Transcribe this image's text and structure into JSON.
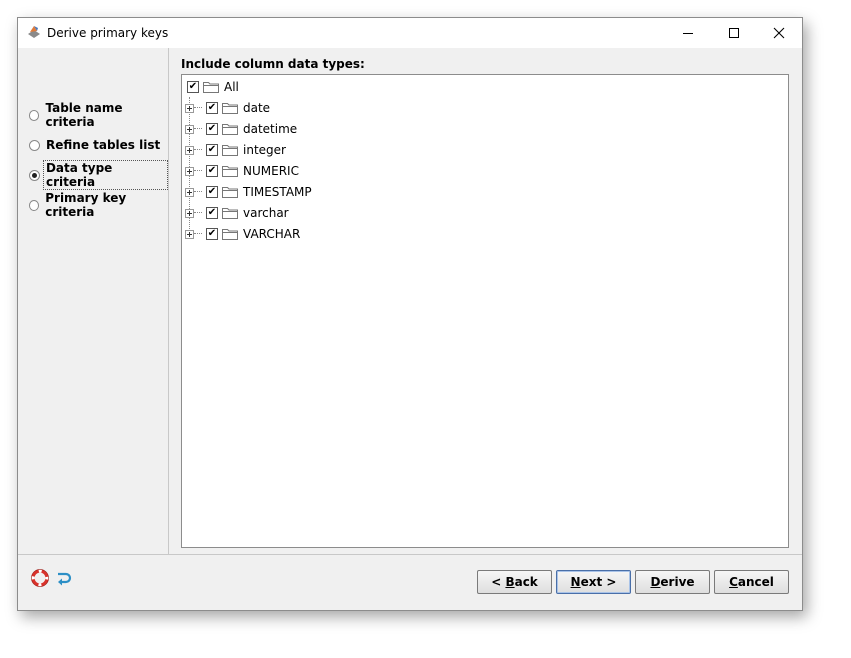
{
  "window": {
    "title": "Derive primary keys"
  },
  "steps": [
    {
      "label": "Table name criteria",
      "selected": false
    },
    {
      "label": "Refine tables list",
      "selected": false
    },
    {
      "label": "Data type criteria",
      "selected": true
    },
    {
      "label": "Primary key criteria",
      "selected": false
    }
  ],
  "content": {
    "label": "Include column data types:",
    "tree": {
      "root": {
        "label": "All",
        "checked": true
      },
      "items": [
        {
          "label": "date",
          "checked": true
        },
        {
          "label": "datetime",
          "checked": true
        },
        {
          "label": "integer",
          "checked": true
        },
        {
          "label": "NUMERIC",
          "checked": true
        },
        {
          "label": "TIMESTAMP",
          "checked": true
        },
        {
          "label": "varchar",
          "checked": true
        },
        {
          "label": "VARCHAR",
          "checked": true
        }
      ]
    }
  },
  "buttons": {
    "back_prefix": "< ",
    "back_mnemonic": "B",
    "back_rest": "ack",
    "next_mnemonic": "N",
    "next_rest": "ext >",
    "derive_mnemonic": "D",
    "derive_rest": "erive",
    "cancel_mnemonic": "C",
    "cancel_rest": "ancel"
  },
  "icons": {
    "help": "lifebuoy-icon",
    "reset": "undo-arrow-icon",
    "minimize": "minimize-icon",
    "maximize": "maximize-icon",
    "close": "close-icon",
    "check": "✔"
  },
  "colors": {
    "accent": "#4a6fa8",
    "help_red": "#d9322b",
    "reset_blue": "#2c8fc6"
  }
}
